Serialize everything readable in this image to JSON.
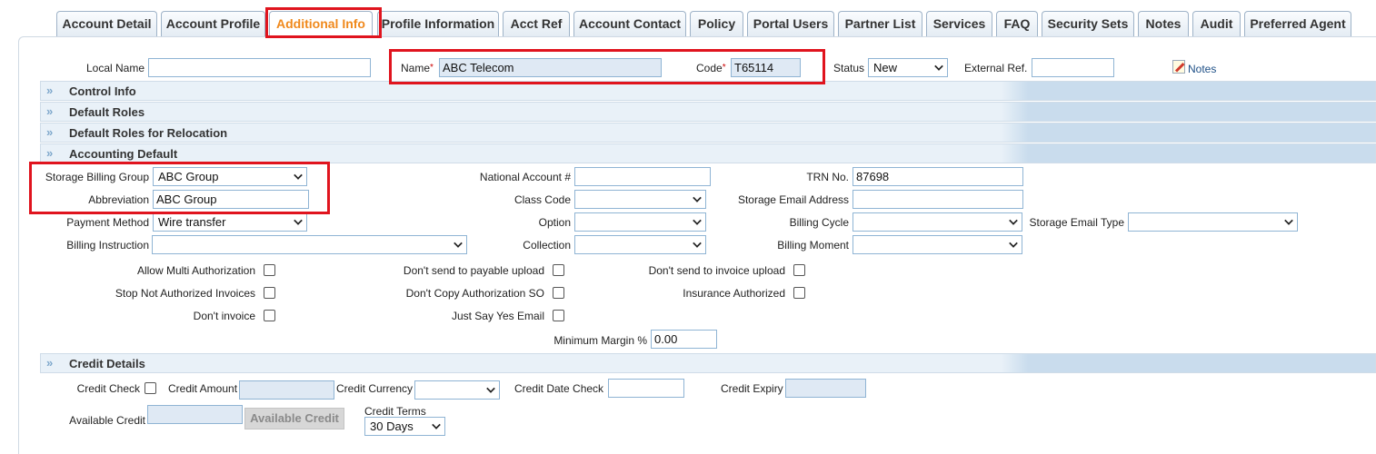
{
  "tabs": [
    {
      "label": "Account Detail"
    },
    {
      "label": "Account Profile"
    },
    {
      "label": "Additional Info",
      "active": true
    },
    {
      "label": "Profile Information"
    },
    {
      "label": "Acct Ref"
    },
    {
      "label": "Account Contact"
    },
    {
      "label": "Policy"
    },
    {
      "label": "Portal Users"
    },
    {
      "label": "Partner List"
    },
    {
      "label": "Services"
    },
    {
      "label": "FAQ"
    },
    {
      "label": "Security Sets"
    },
    {
      "label": "Notes"
    },
    {
      "label": "Audit"
    },
    {
      "label": "Preferred Agent"
    }
  ],
  "header": {
    "local_name_label": "Local Name",
    "local_name_value": "",
    "name_label": "Name",
    "name_value": "ABC Telecom",
    "code_label": "Code",
    "code_value": "T65114",
    "required_mark": "*",
    "status_label": "Status",
    "status_value": "New",
    "external_ref_label": "External Ref.",
    "external_ref_value": "",
    "notes_label": "Notes"
  },
  "sections": {
    "control_info": "Control Info",
    "default_roles": "Default Roles",
    "default_roles_relocation": "Default Roles for Relocation",
    "accounting_default": "Accounting Default",
    "credit_details": "Credit Details",
    "chevron": "»"
  },
  "accounting": {
    "storage_billing_group_label": "Storage Billing Group",
    "storage_billing_group_value": "ABC Group",
    "abbreviation_label": "Abbreviation",
    "abbreviation_value": "ABC Group",
    "payment_method_label": "Payment Method",
    "payment_method_value": "Wire transfer",
    "billing_instruction_label": "Billing Instruction",
    "billing_instruction_value": "",
    "national_account_label": "National Account #",
    "national_account_value": "",
    "class_code_label": "Class Code",
    "class_code_value": "",
    "option_label": "Option",
    "option_value": "",
    "collection_label": "Collection",
    "collection_value": "",
    "trn_label": "TRN No.",
    "trn_value": "87698",
    "storage_email_address_label": "Storage Email Address",
    "storage_email_address_value": "",
    "billing_cycle_label": "Billing Cycle",
    "billing_cycle_value": "",
    "billing_moment_label": "Billing Moment",
    "billing_moment_value": "",
    "storage_email_type_label": "Storage Email Type",
    "storage_email_type_value": "",
    "allow_multi_auth_label": "Allow Multi Authorization",
    "stop_not_authorized_label": "Stop Not Authorized Invoices",
    "dont_invoice_label": "Don't invoice",
    "dont_send_payable_label": "Don't send to payable upload",
    "dont_copy_auth_label": "Don't Copy Authorization SO",
    "just_say_yes_label": "Just Say Yes Email",
    "dont_send_invoice_label": "Don't send to invoice upload",
    "insurance_authorized_label": "Insurance Authorized",
    "minimum_margin_label": "Minimum Margin %",
    "minimum_margin_value": "0.00"
  },
  "credit": {
    "credit_check_label": "Credit Check",
    "credit_amount_label": "Credit Amount",
    "credit_amount_value": "",
    "credit_currency_label": "Credit Currency",
    "credit_currency_value": "",
    "credit_date_check_label": "Credit Date Check",
    "credit_date_check_value": "",
    "credit_expiry_label": "Credit Expiry",
    "credit_expiry_value": "",
    "available_credit_label": "Available Credit",
    "available_credit_value": "",
    "available_credit_button": "Available Credit",
    "credit_terms_label": "Credit Terms",
    "credit_terms_value": "30 Days"
  },
  "colors": {
    "active_tab_text": "#f0891c",
    "highlight_border": "#e0141e",
    "section_bg": "#e9f1f8",
    "input_border": "#8fb4d4",
    "readonly_input_bg": "#dfe9f4"
  }
}
